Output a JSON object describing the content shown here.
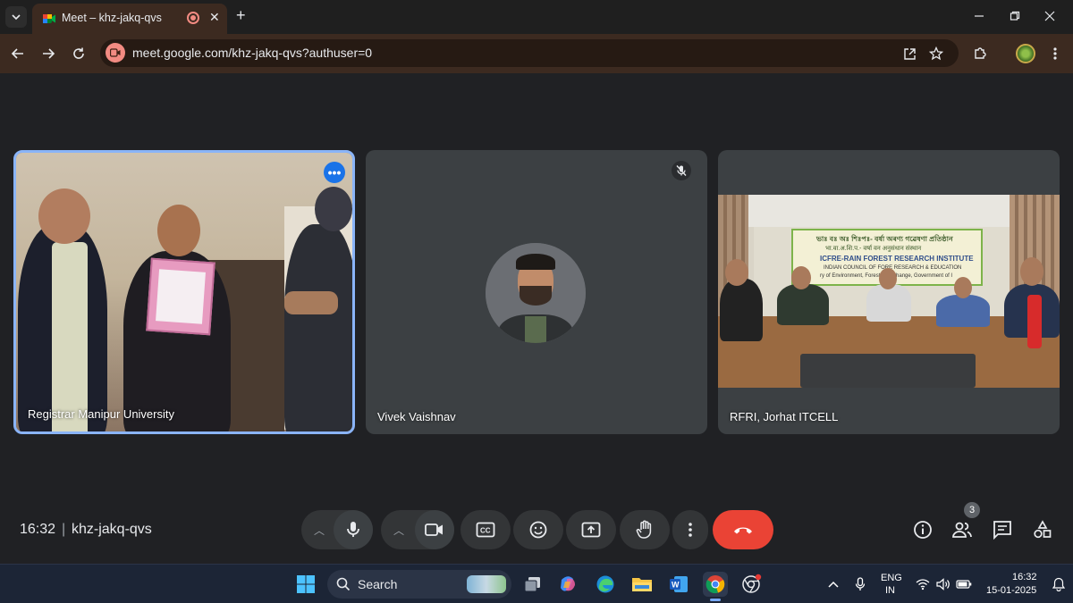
{
  "browser": {
    "tab_title": "Meet – khz-jakq-qvs",
    "url": "meet.google.com/khz-jakq-qvs?authuser=0"
  },
  "meeting": {
    "time": "16:32",
    "separator": "|",
    "code": "khz-jakq-qvs",
    "people_count": "3"
  },
  "tiles": [
    {
      "name": "Registrar Manipur University",
      "active_speaker": true
    },
    {
      "name": "Vivek Vaishnav",
      "muted": true
    },
    {
      "name": "RFRI, Jorhat ITCELL"
    }
  ],
  "banner": {
    "line1": "ভাঃ বঃ অঃ শিঃপঃ- বৰ্ষা অৰণ্য গৱেষণা প্ৰতিষ্ঠান",
    "line2": "भा.वा.अ.शि.प.- वर्षा वन अनुसंधान संस्थान",
    "line3": "ICFRE-RAIN FOREST RESEARCH INSTITUTE",
    "line4": "INDIAN COUNCIL OF FORE  RESEARCH & EDUCATION",
    "line5": "ry of Environment, Forest a   te Change, Government of I"
  },
  "taskbar": {
    "search_label": "Search",
    "lang_top": "ENG",
    "lang_bottom": "IN",
    "time": "16:32",
    "date": "15-01-2025"
  },
  "colors": {
    "end_call": "#ea4335",
    "active_tile_border": "#8ab4f8",
    "meet_bg": "#202124",
    "browser_toolbar": "#3c2a20"
  }
}
